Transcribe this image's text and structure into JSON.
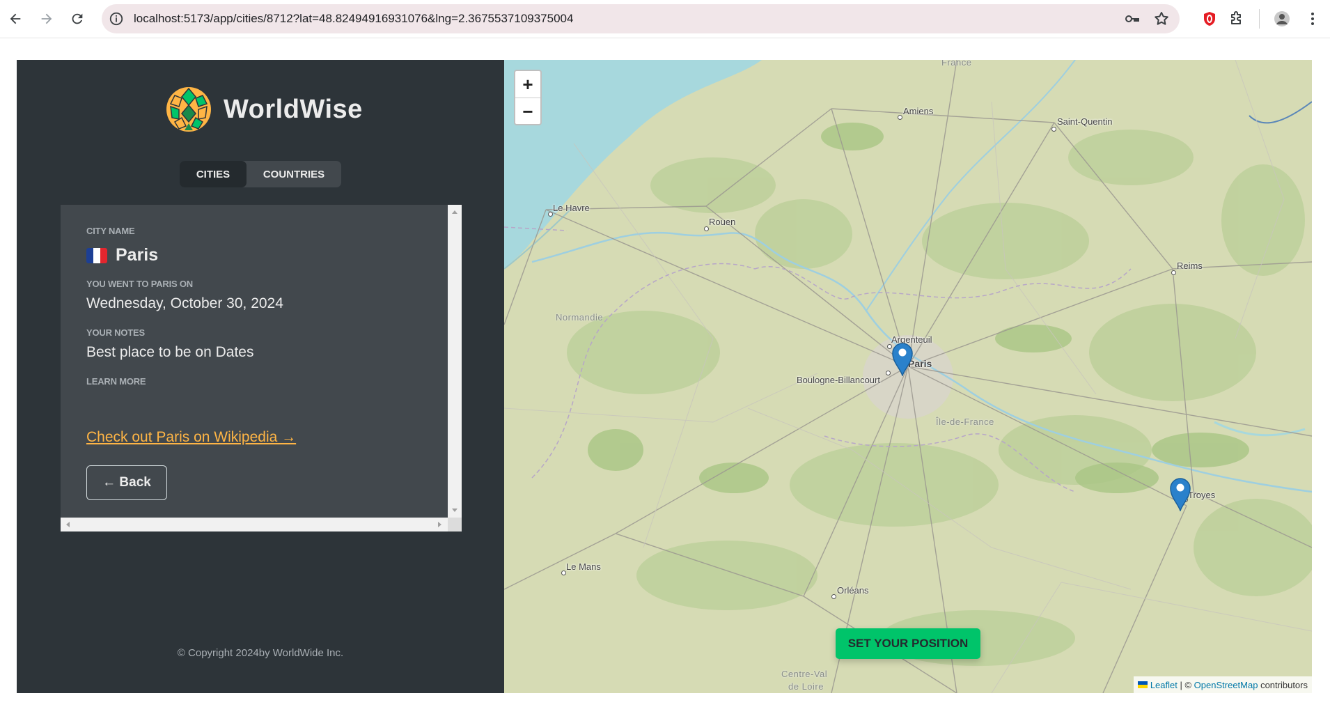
{
  "browser": {
    "url": "localhost:5173/app/cities/8712?lat=48.82494916931076&lng=2.3675537109375004",
    "icons": [
      "back-arrow-icon",
      "forward-arrow-icon",
      "reload-icon",
      "site-info-icon",
      "password-key-icon",
      "bookmark-star-icon",
      "opera-extension-icon",
      "extensions-puzzle-icon",
      "profile-avatar-icon",
      "menu-kebab-icon"
    ]
  },
  "app": {
    "brand": "WorldWise",
    "tabs": [
      {
        "label": "Cities",
        "active": true
      },
      {
        "label": "Countries",
        "active": false
      }
    ],
    "city": {
      "name_label": "City name",
      "flag": "France",
      "name": "Paris",
      "visit_label": "You went to Paris on",
      "visit_date": "Wednesday, October 30, 2024",
      "notes_label": "Your notes",
      "notes": "Best place to be on Dates",
      "learn_label": "Learn more",
      "wiki_link": "Check out Paris on Wikipedia →",
      "back_button": "← Back"
    },
    "copyright": "© Copyright 2024by WorldWide Inc."
  },
  "map": {
    "zoom_in": "+",
    "zoom_out": "−",
    "places": {
      "amiens": "Amiens",
      "saint_quentin": "Saint-Quentin",
      "le_havre": "Le Havre",
      "rouen": "Rouen",
      "reims": "Reims",
      "normandie": "Normandie",
      "argenteuil": "Argenteuil",
      "paris": "Paris",
      "boulogne": "Boulogne-Billancourt",
      "ile_de_france": "Île-de-France",
      "troyes": "Troyes",
      "le_mans": "Le Mans",
      "orleans": "Orléans",
      "centre_val_de_loire_1": "Centre-Val",
      "centre_val_de_loire_2": "de Loire",
      "hauts_de_france": "France"
    },
    "markers": [
      {
        "city": "Paris",
        "color": "#2a81cb"
      },
      {
        "city": "Troyes",
        "color": "#2a81cb"
      }
    ],
    "set_position_button": "Set your position",
    "attribution": {
      "leaflet": "Leaflet",
      "separator": " | © ",
      "osm": "OpenStreetMap",
      "suffix": " contributors"
    }
  },
  "colors": {
    "sidebar_bg": "#2d3439",
    "panel_bg": "#42484d",
    "accent_link": "#ffb545",
    "brand_green": "#00c46a",
    "marker_blue": "#2a81cb",
    "sea": "#a7d8dd"
  }
}
